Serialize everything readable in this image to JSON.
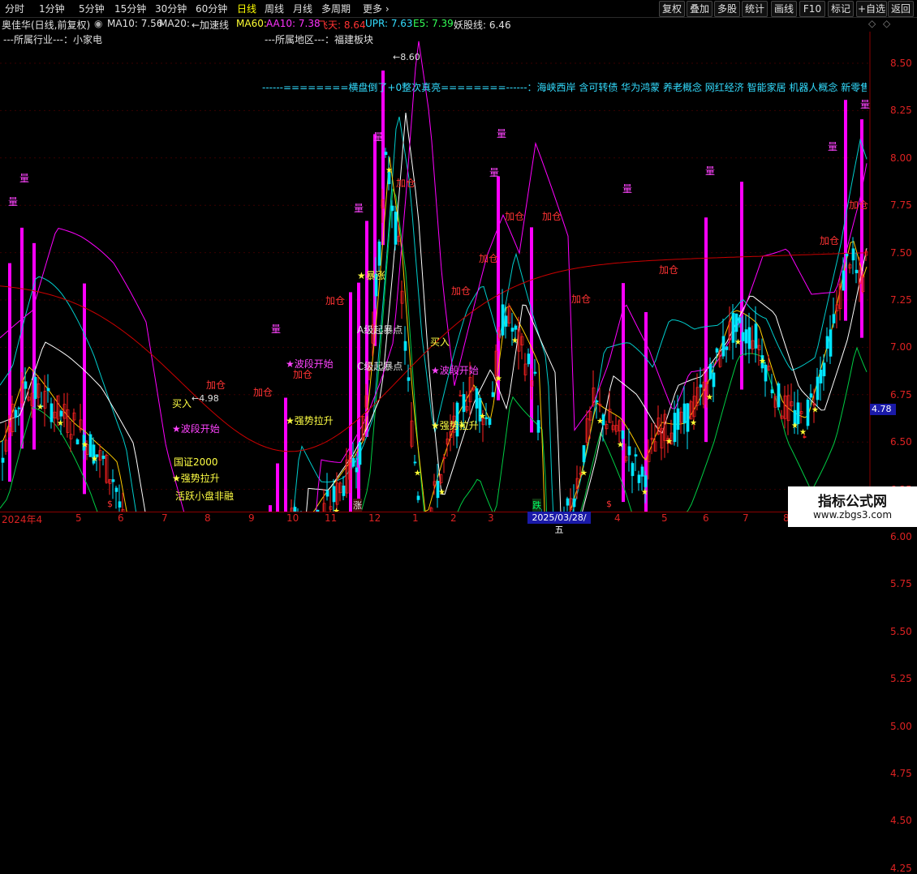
{
  "toolbar": {
    "periods": [
      "分时",
      "1分钟",
      "5分钟",
      "15分钟",
      "30分钟",
      "60分钟",
      "日线",
      "周线",
      "月线",
      "多周期",
      "更多"
    ],
    "active_period": "日线",
    "buttons": [
      "复权",
      "叠加",
      "多股",
      "统计",
      "画线",
      "F10",
      "标记",
      "+自选",
      "返回"
    ]
  },
  "info": {
    "stock": "奥佳华(日线,前复权)",
    "ma10": "MA10: 7.56",
    "ma20": "MA20:",
    "accel": "←加速线",
    "ma60": "MA60:",
    "aa10": "AA10: 7.38",
    "fly": "飞天: 8.64",
    "upr": "UPR: 7.63",
    "e5": "E5: 7.39",
    "yao": "妖股线: 6.46"
  },
  "overlay": {
    "industry": "---所属行业---：小家电",
    "region": "---所属地区---：福建板块",
    "concepts": "------========横盘倒了+0整次真亮========------：海峡西岸 含可转债 华为鸿蒙 养老概念 网红经济 智能家居 机器人概念 新零售 跨境电商 人工",
    "a_level": "A级起暴点",
    "c_level": "C级起暴点",
    "buy1": "买入",
    "buy2": "买入",
    "wave1": "★波段开始",
    "wave2": "★波段开始",
    "wave3": "★波段开始",
    "strong1": "★强势拉升",
    "strong2": "★强势拉升",
    "strong3": "★强势拉升",
    "surge": "★暴涨",
    "index_name": "国证2000",
    "active_small": "活跃小盘非融",
    "add_label": "加仓",
    "vol_label": "量",
    "high_mark": "←8.60",
    "low_mark": "←4.98"
  },
  "chart_data": {
    "type": "candlestick",
    "y_ticks": [
      "8.50",
      "8.25",
      "8.00",
      "7.75",
      "7.50",
      "7.25",
      "7.00",
      "6.75",
      "6.50",
      "6.25",
      "6.00",
      "5.75",
      "5.50",
      "5.25",
      "5.00",
      "4.75",
      "4.50",
      "4.25"
    ],
    "ylim": [
      4.1,
      8.75
    ],
    "x_labels": [
      "2024年4",
      "5",
      "6",
      "7",
      "8",
      "9",
      "10",
      "11",
      "12",
      "1",
      "2",
      "3",
      "4",
      "5",
      "6",
      "7",
      "8"
    ],
    "current_date": "2025/03/28/五",
    "last_price": "4.78",
    "period_high": 8.6,
    "period_low": 4.98,
    "colors": {
      "up": "#ff2222",
      "down": "#00e5ff",
      "ma_white": "#ffffff",
      "ma_yellow": "#ffcc00",
      "ma_magenta": "#ff00ff",
      "ma_green": "#00cc44",
      "ma_red": "#cc0000",
      "ma_cyan": "#00cccc",
      "bar_magenta": "#ff00ff"
    },
    "markers": [
      {
        "label": "$"
      },
      {
        "label": "涨"
      },
      {
        "label": "跌"
      },
      {
        "label": "$"
      }
    ]
  },
  "watermark": {
    "line1": "指标公式网",
    "line2": "www.zbgs3.com"
  }
}
